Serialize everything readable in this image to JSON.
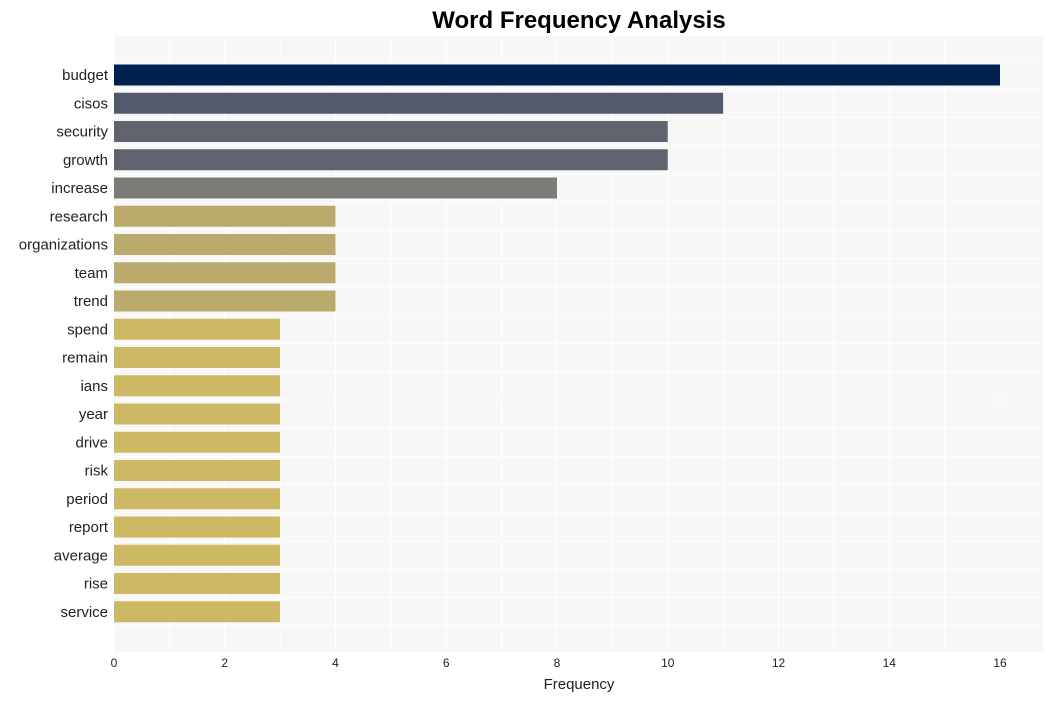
{
  "chart_data": {
    "type": "bar",
    "orientation": "horizontal",
    "title": "Word Frequency Analysis",
    "xlabel": "Frequency",
    "ylabel": "",
    "xlim": [
      0,
      16.8
    ],
    "xticks": [
      0,
      2,
      4,
      6,
      8,
      10,
      12,
      14,
      16
    ],
    "grid": true,
    "categories": [
      "budget",
      "cisos",
      "security",
      "growth",
      "increase",
      "research",
      "organizations",
      "team",
      "trend",
      "spend",
      "remain",
      "ians",
      "year",
      "drive",
      "risk",
      "period",
      "report",
      "average",
      "rise",
      "service"
    ],
    "values": [
      16,
      11,
      10,
      10,
      8,
      4,
      4,
      4,
      4,
      3,
      3,
      3,
      3,
      3,
      3,
      3,
      3,
      3,
      3,
      3
    ],
    "colors": [
      "#00204e",
      "#53596c",
      "#5f636e",
      "#5f636e",
      "#7d7b77",
      "#baab6d",
      "#baab6d",
      "#baab6d",
      "#baab6d",
      "#cdb963",
      "#cdb963",
      "#cdb963",
      "#cdb963",
      "#cdb963",
      "#cdb963",
      "#cdb963",
      "#cdb963",
      "#cdb963",
      "#cdb963",
      "#cdb963"
    ]
  }
}
